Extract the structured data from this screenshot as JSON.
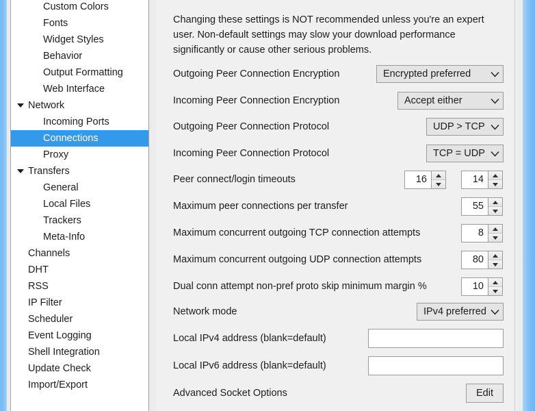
{
  "window": {
    "accent_color": "#79bbf4",
    "panel_bg": "#f0f0f0",
    "selection_color": "#3399ea"
  },
  "sidebar": {
    "name": "settings-tree",
    "items": [
      {
        "label": "Custom Colors",
        "level": 1,
        "expander": false,
        "selected": false
      },
      {
        "label": "Fonts",
        "level": 1,
        "expander": false,
        "selected": false
      },
      {
        "label": "Widget Styles",
        "level": 1,
        "expander": false,
        "selected": false
      },
      {
        "label": "Behavior",
        "level": 1,
        "expander": false,
        "selected": false
      },
      {
        "label": "Output Formatting",
        "level": 1,
        "expander": false,
        "selected": false
      },
      {
        "label": "Web Interface",
        "level": 1,
        "expander": false,
        "selected": false
      },
      {
        "label": "Network",
        "level": 0,
        "expander": true,
        "selected": false
      },
      {
        "label": "Incoming Ports",
        "level": 1,
        "expander": false,
        "selected": false
      },
      {
        "label": "Connections",
        "level": 1,
        "expander": false,
        "selected": true
      },
      {
        "label": "Proxy",
        "level": 1,
        "expander": false,
        "selected": false
      },
      {
        "label": "Transfers",
        "level": 0,
        "expander": true,
        "selected": false
      },
      {
        "label": "General",
        "level": 1,
        "expander": false,
        "selected": false
      },
      {
        "label": "Local Files",
        "level": 1,
        "expander": false,
        "selected": false
      },
      {
        "label": "Trackers",
        "level": 1,
        "expander": false,
        "selected": false
      },
      {
        "label": "Meta-Info",
        "level": 1,
        "expander": false,
        "selected": false
      },
      {
        "label": "Channels",
        "level": 0,
        "expander": false,
        "selected": false
      },
      {
        "label": "DHT",
        "level": 0,
        "expander": false,
        "selected": false
      },
      {
        "label": "RSS",
        "level": 0,
        "expander": false,
        "selected": false
      },
      {
        "label": "IP Filter",
        "level": 0,
        "expander": false,
        "selected": false
      },
      {
        "label": "Scheduler",
        "level": 0,
        "expander": false,
        "selected": false
      },
      {
        "label": "Event Logging",
        "level": 0,
        "expander": false,
        "selected": false
      },
      {
        "label": "Shell Integration",
        "level": 0,
        "expander": false,
        "selected": false
      },
      {
        "label": "Update Check",
        "level": 0,
        "expander": false,
        "selected": false
      },
      {
        "label": "Import/Export",
        "level": 0,
        "expander": false,
        "selected": false
      }
    ]
  },
  "panel": {
    "warning": "Changing these settings is NOT recommended unless you're an expert user.  Non-default settings may slow your download performance significantly or cause other serious problems.",
    "rows": {
      "outgoing_encryption": {
        "label": "Outgoing Peer Connection Encryption",
        "value": "Encrypted preferred"
      },
      "incoming_encryption": {
        "label": "Incoming Peer Connection Encryption",
        "value": "Accept either"
      },
      "outgoing_protocol": {
        "label": "Outgoing Peer Connection Protocol",
        "value": "UDP > TCP"
      },
      "incoming_protocol": {
        "label": "Incoming Peer Connection Protocol",
        "value": "TCP = UDP"
      },
      "timeouts": {
        "label": "Peer connect/login timeouts",
        "connect_value": "16",
        "login_value": "14"
      },
      "max_peer_connections": {
        "label": "Maximum peer connections per transfer",
        "value": "55"
      },
      "max_tcp_attempts": {
        "label": "Maximum concurrent outgoing TCP connection attempts",
        "value": "8"
      },
      "max_udp_attempts": {
        "label": "Maximum concurrent outgoing UDP connection attempts",
        "value": "80"
      },
      "dual_conn_margin": {
        "label": "Dual conn attempt non-pref proto skip minimum margin %",
        "value": "10"
      },
      "network_mode": {
        "label": "Network mode",
        "value": "IPv4 preferred"
      },
      "local_ipv4": {
        "label": "Local IPv4 address (blank=default)",
        "value": "",
        "placeholder": ""
      },
      "local_ipv6": {
        "label": "Local IPv6 address (blank=default)",
        "value": "",
        "placeholder": ""
      },
      "advanced_socket": {
        "label": "Advanced Socket Options",
        "button_label": "Edit"
      }
    }
  }
}
